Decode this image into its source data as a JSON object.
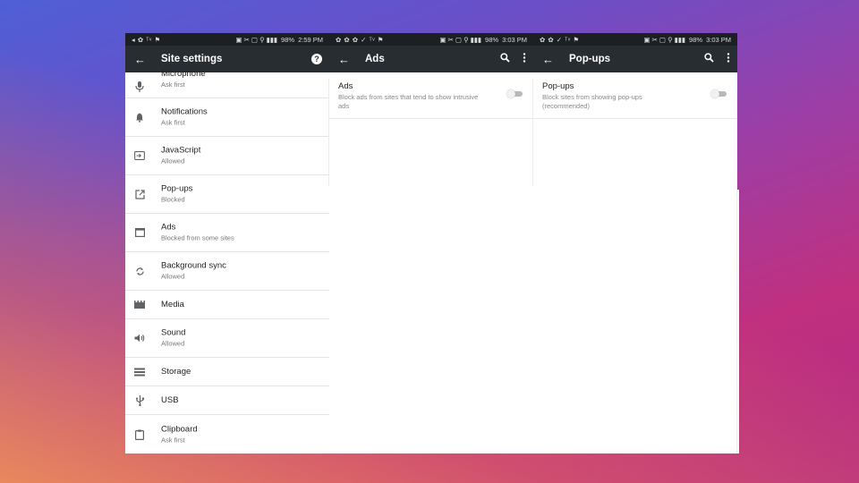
{
  "background": {
    "gradient_colors": [
      "#4f5fd6",
      "#9a3fa8",
      "#c0307f",
      "#ec8c5a"
    ]
  },
  "colors": {
    "appbar": "#272d30",
    "statusbar": "#1c2022",
    "toggle_track": "#b9b9b9",
    "toggle_thumb": "#f1f1f1"
  },
  "screens": [
    {
      "status": {
        "left_icons": "◂ ✿ ᵀᵛ ⚑",
        "right_icons": "▣ ✂ ▢ ⚲ ▮▮▮",
        "battery": "98%",
        "time": "2:59 PM"
      },
      "appbar": {
        "title": "Site settings",
        "action_icon": "help-icon"
      },
      "items": [
        {
          "title": "Microphone",
          "subtitle": "Ask first",
          "icon": "microphone-icon"
        },
        {
          "title": "Notifications",
          "subtitle": "Ask first",
          "icon": "bell-icon"
        },
        {
          "title": "JavaScript",
          "subtitle": "Allowed",
          "icon": "javascript-icon"
        },
        {
          "title": "Pop-ups",
          "subtitle": "Blocked",
          "icon": "open-in-new-icon"
        },
        {
          "title": "Ads",
          "subtitle": "Blocked from some sites",
          "icon": "web-window-icon"
        },
        {
          "title": "Background sync",
          "subtitle": "Allowed",
          "icon": "sync-icon"
        },
        {
          "title": "Media",
          "subtitle": "",
          "icon": "film-icon"
        },
        {
          "title": "Sound",
          "subtitle": "Allowed",
          "icon": "speaker-icon"
        },
        {
          "title": "Storage",
          "subtitle": "",
          "icon": "storage-icon"
        },
        {
          "title": "USB",
          "subtitle": "",
          "icon": "usb-icon"
        },
        {
          "title": "Clipboard",
          "subtitle": "Ask first",
          "icon": "clipboard-icon"
        }
      ]
    },
    {
      "status": {
        "left_icons": "✿ ✿ ✿ ✓ ᵀᵛ ⚑",
        "right_icons": "▣ ✂ ▢ ⚲ ▮▮▮",
        "battery": "98%",
        "time": "3:03 PM"
      },
      "appbar": {
        "title": "Ads"
      },
      "setting": {
        "title": "Ads",
        "subtitle": "Block ads from sites that tend to show intrusive ads",
        "toggle_on": false
      }
    },
    {
      "status": {
        "left_icons": "✿ ✿ ✓ ᵀᵛ ⚑",
        "right_icons": "▣ ✂ ▢ ⚲ ▮▮▮",
        "battery": "98%",
        "time": "3:03 PM"
      },
      "appbar": {
        "title": "Pop-ups"
      },
      "setting": {
        "title": "Pop-ups",
        "subtitle": "Block sites from showing pop-ups (recommended)",
        "toggle_on": false
      }
    }
  ]
}
